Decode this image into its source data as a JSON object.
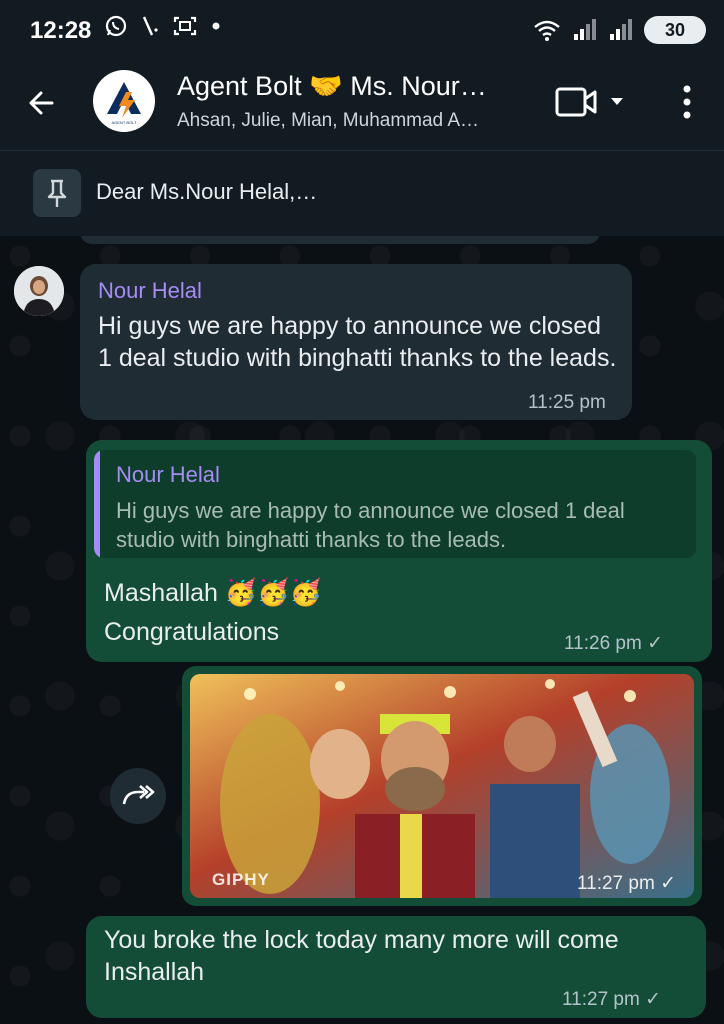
{
  "status_bar": {
    "time": "12:28",
    "icons": [
      "whatsapp-icon",
      "slash-icon",
      "scan-icon",
      "dot-icon"
    ],
    "battery": "30"
  },
  "header": {
    "title": "Agent Bolt 🤝 Ms. Nour…",
    "subtitle": "Ahsan, Julie, Mian, Muhammad A…",
    "logo_text": "AGENT BOLT"
  },
  "pinned": {
    "text": "Dear Ms.Nour Helal,…"
  },
  "messages": [
    {
      "sender": "Nour Helal",
      "text": "Hi guys we are happy to announce we closed 1 deal studio with binghatti thanks to the leads.",
      "time": "11:25 pm"
    },
    {
      "quote_sender": "Nour Helal",
      "quote_text": "Hi guys we are happy to announce we closed 1 deal studio with binghatti thanks to the leads.",
      "line1": "Mashallah",
      "emojis": "🥳🥳🥳",
      "line2": "Congratulations",
      "time": "11:26 pm",
      "status": "✓"
    },
    {
      "gif_label": "GIPHY",
      "time": "11:27 pm",
      "status": "✓"
    },
    {
      "text": "You broke the lock today many more will come Inshallah",
      "time": "11:27 pm",
      "status": "✓"
    }
  ],
  "colors": {
    "background": "#0b1014",
    "header": "#121b22",
    "incoming_bubble": "#202c33",
    "outgoing_bubble": "#134d37",
    "sender_name": "#a68cf6"
  }
}
